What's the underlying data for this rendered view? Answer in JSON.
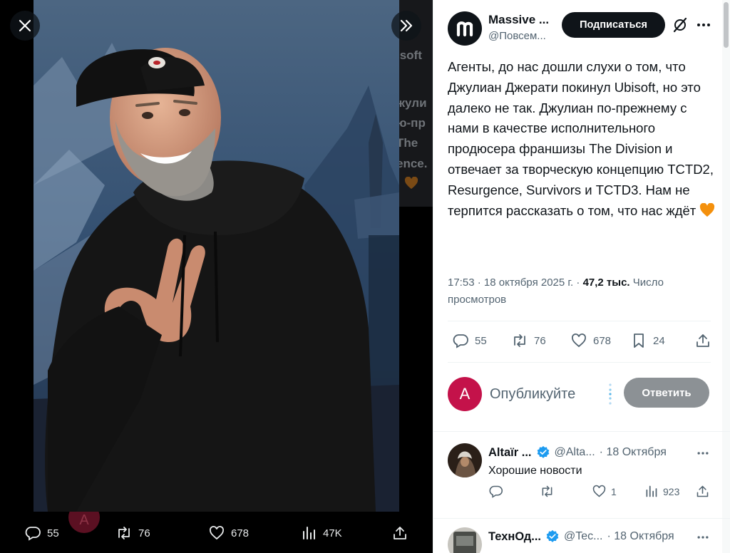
{
  "viewer": {
    "ghost_lines": [
      "isoft",
      "жули",
      "ю-пр",
      "The",
      "ence."
    ],
    "ghost_avatar_letter": "A",
    "actions": {
      "replies": "55",
      "retweets": "76",
      "likes": "678",
      "views": "47K"
    }
  },
  "tweet": {
    "author_name": "Massive ...",
    "author_handle": "@Повсем...",
    "follow_label": "Подписаться",
    "text": "Агенты, до нас дошли слухи о том, что Джулиан Джерати покинул Ubisoft, но это далеко не так. Джулиан по-прежнему с нами в качестве исполнительного продюсера франшизы The Division и отвечает за творческую концепцию TCTD2, Resurgence, Survivors и TCTD3. Нам не терпится рассказать о том, что нас ждёт",
    "time": "17:53",
    "date": "18 октября 2025 г.",
    "views_count": "47,2 тыс.",
    "views_label": "Число просмотров",
    "stats": {
      "replies": "55",
      "retweets": "76",
      "likes": "678",
      "bookmarks": "24"
    }
  },
  "reply": {
    "avatar_letter": "A",
    "placeholder": "Опубликуйте",
    "button_label": "Ответить"
  },
  "comments": [
    {
      "name": "Altaïr ...",
      "handle": "@Alta...",
      "date": "· 18 Октября",
      "text": "Хорошие новости",
      "replies": "",
      "retweets": "",
      "likes": "1",
      "views": "923"
    },
    {
      "name": "ТехнОд...",
      "handle": "@Tec...",
      "date": "· 18 Октября"
    }
  ],
  "colors": {
    "follow_bg": "#0f1419",
    "reply_btn_bg": "#8c9195",
    "my_avatar_bg": "#c4124a",
    "verified": "#1d9bf0",
    "heart": "#f4900c"
  }
}
